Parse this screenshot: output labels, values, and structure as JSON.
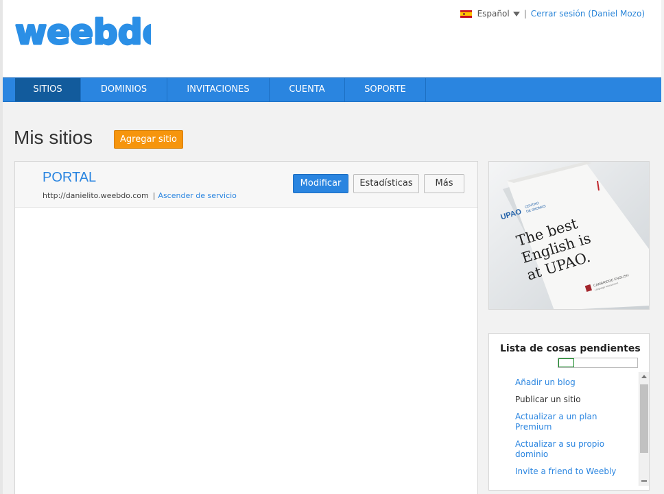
{
  "header": {
    "logo_text": "weebdo",
    "language": "Español",
    "separator": "|",
    "logout": "Cerrar sesión (Daniel Mozo)"
  },
  "nav": {
    "items": [
      {
        "label": "SITIOS",
        "active": true
      },
      {
        "label": "DOMINIOS",
        "active": false
      },
      {
        "label": "INVITACIONES",
        "active": false
      },
      {
        "label": "CUENTA",
        "active": false
      },
      {
        "label": "SOPORTE",
        "active": false
      }
    ]
  },
  "main": {
    "title": "Mis sitios",
    "add_button": "Agregar sitio",
    "site": {
      "name": "PORTAL",
      "url": "http://danielito.weebdo.com",
      "separator": "|",
      "upgrade_link": "Ascender de servicio",
      "buttons": {
        "modify": "Modificar",
        "stats": "Estadísticas",
        "more": "Más"
      }
    }
  },
  "promo": {
    "brand": "UPAO",
    "subbrand_1": "CENTRO",
    "subbrand_2": "DE IDIOMAS",
    "headline_1": "The best",
    "headline_2": "English is",
    "headline_3": "at UPAO.",
    "footer_1": "CAMBRIDGE ENGLISH",
    "footer_2": "Language Assessment"
  },
  "todo": {
    "title": "Lista de cosas pendientes",
    "progress": 0.2,
    "items": [
      {
        "label": "Añadir un blog",
        "done": false
      },
      {
        "label": "Publicar un sitio",
        "done": true
      },
      {
        "label": "Actualizar a un plan Premium",
        "done": false
      },
      {
        "label": "Actualizar a su propio dominio",
        "done": false
      },
      {
        "label": "Invite a friend to Weebly",
        "done": false
      }
    ]
  },
  "colors": {
    "accent_blue": "#2a85e0",
    "nav_active": "#125b9c",
    "orange": "#f6950d"
  }
}
